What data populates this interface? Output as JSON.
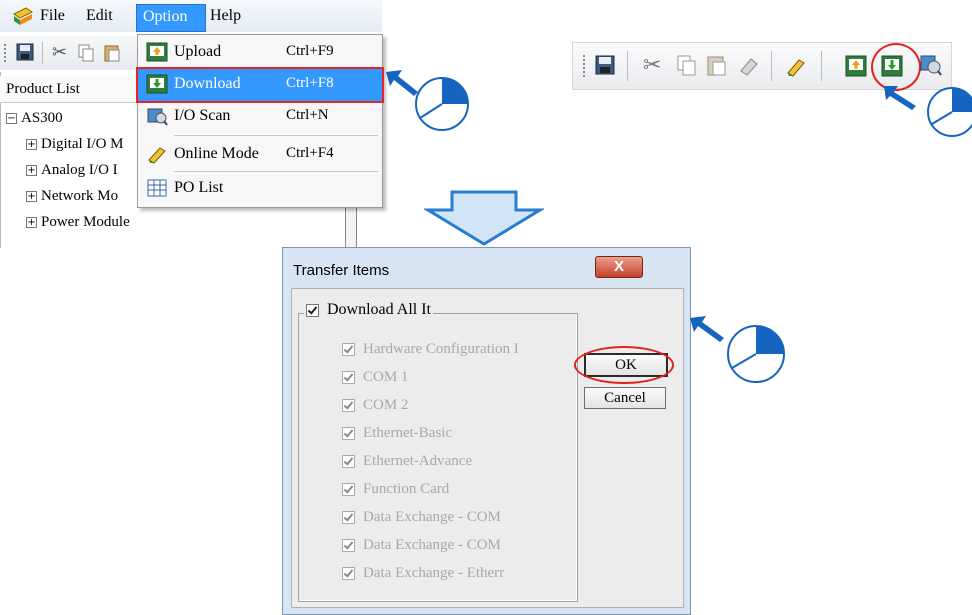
{
  "menubar": {
    "file": "File",
    "edit": "Edit",
    "option": "Option",
    "help": "Help"
  },
  "product_panel": {
    "title": "Product List",
    "root": "AS300",
    "items": [
      "Digital I/O M",
      "Analog I/O I",
      "Network Mo",
      "Power Module"
    ]
  },
  "option_menu": {
    "items": [
      {
        "label": "Upload",
        "shortcut": "Ctrl+F9",
        "icon": "upload-icon"
      },
      {
        "label": "Download",
        "shortcut": "Ctrl+F8",
        "icon": "download-icon",
        "selected": true
      },
      {
        "label": "I/O Scan",
        "shortcut": "Ctrl+N",
        "icon": "io-scan-icon"
      },
      {
        "label": "Online Mode",
        "shortcut": "Ctrl+F4",
        "icon": "online-mode-icon"
      },
      {
        "label": "PO List",
        "shortcut": "",
        "icon": "po-list-icon"
      }
    ]
  },
  "dialog": {
    "title": "Transfer Items",
    "close_label": "X",
    "group_label": "Download All It",
    "ok_label": "OK",
    "cancel_label": "Cancel",
    "items": [
      "Hardware Configuration I",
      "COM 1",
      "COM 2",
      "Ethernet-Basic",
      "Ethernet-Advance",
      "Function Card",
      "Data Exchange - COM",
      "Data Exchange - COM",
      "Data Exchange - Etherr"
    ]
  },
  "colors": {
    "highlight_red": "#e3201c",
    "selection_blue": "#3399ff",
    "pointer_blue": "#1565c0"
  }
}
